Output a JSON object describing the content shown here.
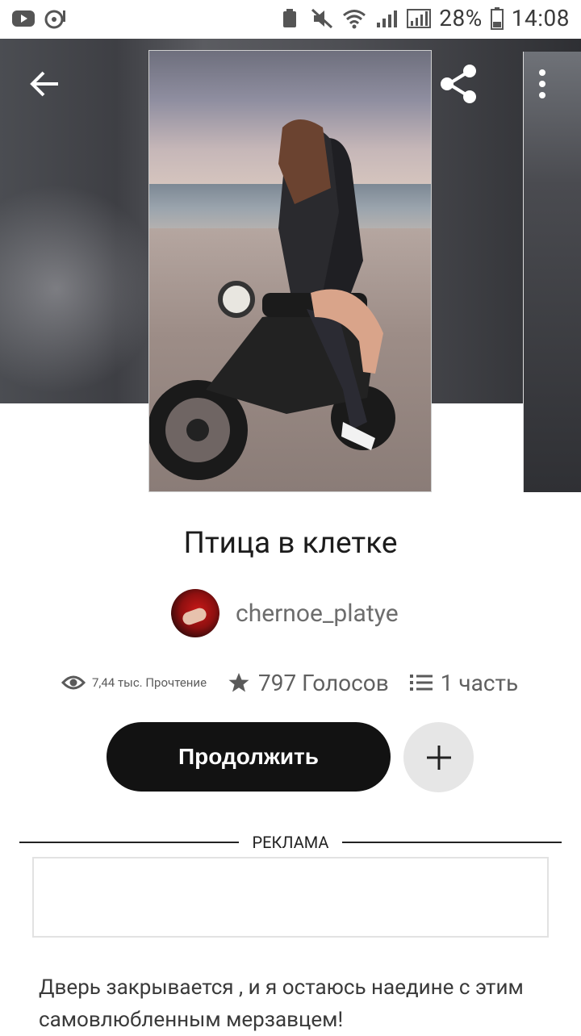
{
  "status_bar": {
    "battery": "28%",
    "time": "14:08",
    "icons": [
      "youtube-icon",
      "music-icon",
      "storage-cleaner-icon",
      "mute-icon",
      "wifi-icon",
      "signal-icon",
      "signal-icon",
      "battery-icon"
    ]
  },
  "header": {
    "back_icon": "arrow-left-icon",
    "share_icon": "share-icon",
    "more_icon": "more-vertical-icon"
  },
  "story": {
    "title": "Птица в клетке",
    "author": "chernoe_platye",
    "stats": {
      "reads": "7,44 тыс. Прочтение",
      "votes": "797 Голосов",
      "parts": "1 часть"
    },
    "continue_label": "Продолжить",
    "add_icon": "plus-icon",
    "description": "Дверь закрывается , и я остаюсь наедине с этим самовлюбленным мерзавцем!"
  },
  "ad": {
    "label": "РЕКЛАМА"
  }
}
